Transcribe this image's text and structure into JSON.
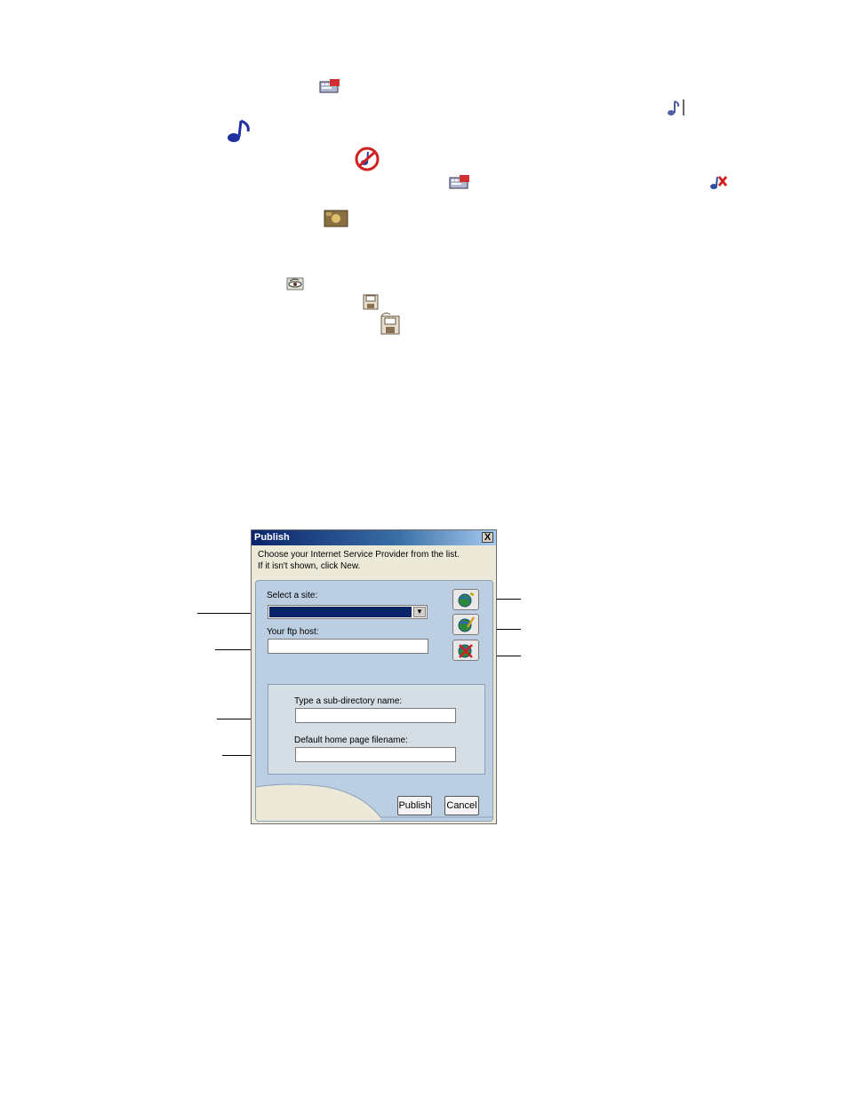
{
  "dialog": {
    "title": "Publish",
    "close_label": "X",
    "instructions_line1": "Choose your Internet Service Provider from the list.",
    "instructions_line2": "If it isn't shown, click New.",
    "select_site_label": "Select a site:",
    "select_site_value": "",
    "ftp_host_label": "Your ftp host:",
    "ftp_host_value": "",
    "subdir_label": "Type a sub-directory name:",
    "subdir_value": "",
    "homepage_label": "Default home page filename:",
    "homepage_value": "",
    "publish_button": "Publish",
    "cancel_button": "Cancel",
    "side_buttons": [
      "new-site-icon",
      "edit-site-icon",
      "delete-site-icon"
    ]
  },
  "document_icons": [
    "keyboard-icon",
    "music-note-end-icon",
    "music-note-icon",
    "no-music-icon",
    "keyboard-icon",
    "music-cut-icon",
    "photo-icon",
    "eye-icon",
    "floppy-save-icon",
    "floppy-save-as-icon"
  ]
}
